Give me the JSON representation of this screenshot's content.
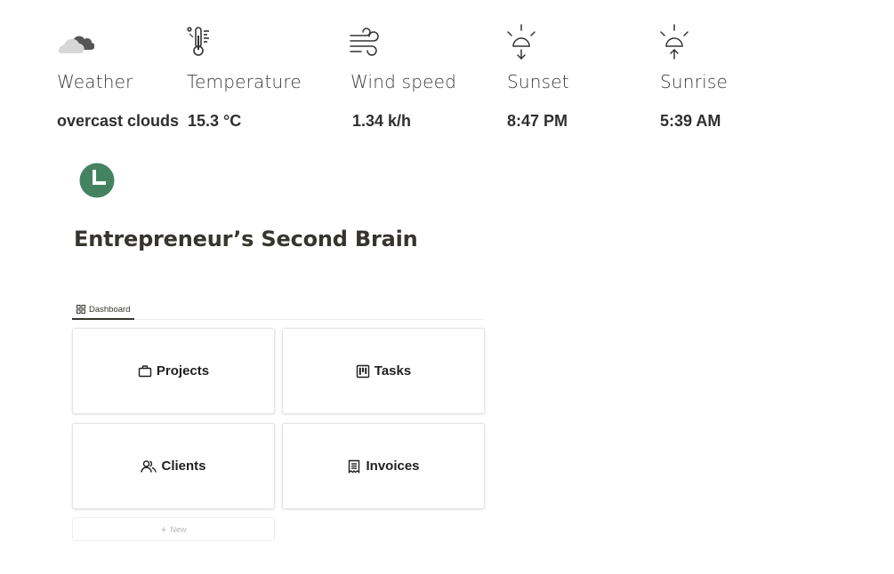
{
  "weather": {
    "items": [
      {
        "label": "Weather",
        "value": "overcast clouds",
        "icon": "cloud-icon"
      },
      {
        "label": "Temperature",
        "value": "15.3 °C",
        "icon": "thermometer-icon"
      },
      {
        "label": "Wind speed",
        "value": "1.34 k/h",
        "icon": "wind-icon"
      },
      {
        "label": "Sunset",
        "value": "8:47 PM",
        "icon": "sunset-icon"
      },
      {
        "label": "Sunrise",
        "value": "5:39 AM",
        "icon": "sunrise-icon"
      }
    ]
  },
  "page": {
    "icon": "clock-icon",
    "icon_color": "#448361",
    "title": "Entrepreneur’s Second Brain"
  },
  "tabs": [
    {
      "label": "Dashboard",
      "icon": "gallery-grid-icon",
      "active": true
    }
  ],
  "cards": [
    {
      "label": "Projects",
      "icon": "briefcase-icon"
    },
    {
      "label": "Tasks",
      "icon": "kanban-icon"
    },
    {
      "label": "Clients",
      "icon": "people-icon"
    },
    {
      "label": "Invoices",
      "icon": "receipt-icon"
    }
  ],
  "new_button": {
    "label": "New",
    "icon": "plus-icon"
  }
}
